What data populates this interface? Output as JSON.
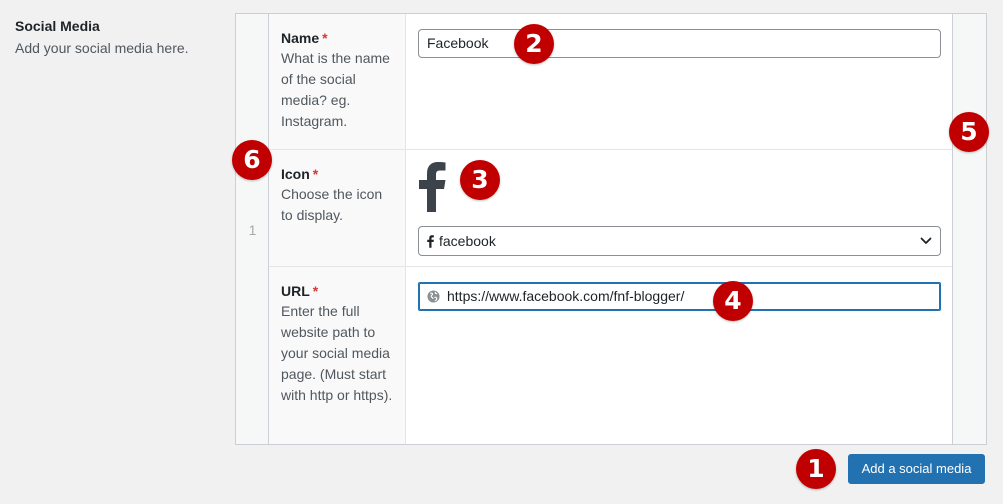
{
  "field": {
    "label": "Social Media",
    "description": "Add your social media here."
  },
  "row": {
    "number": "1"
  },
  "subfields": {
    "name": {
      "label": "Name",
      "required_mark": "*",
      "instructions": "What is the name of the social media? eg. Instagram.",
      "value": "Facebook"
    },
    "icon": {
      "label": "Icon",
      "required_mark": "*",
      "instructions": "Choose the icon to display.",
      "preview_icon": "facebook-icon",
      "selected": "facebook"
    },
    "url": {
      "label": "URL",
      "required_mark": "*",
      "instructions": "Enter the full website path to your social media page. (Must start with http or https).",
      "value": "https://www.facebook.com/fnf-blogger/",
      "icon": "globe-icon"
    }
  },
  "add_button": {
    "label": "Add a social media"
  },
  "callouts": [
    "1",
    "2",
    "3",
    "4",
    "5",
    "6"
  ],
  "colors": {
    "accent": "#2271b1",
    "required": "#d63638",
    "callout": "#c00000",
    "icon_dark": "#3c434a"
  }
}
